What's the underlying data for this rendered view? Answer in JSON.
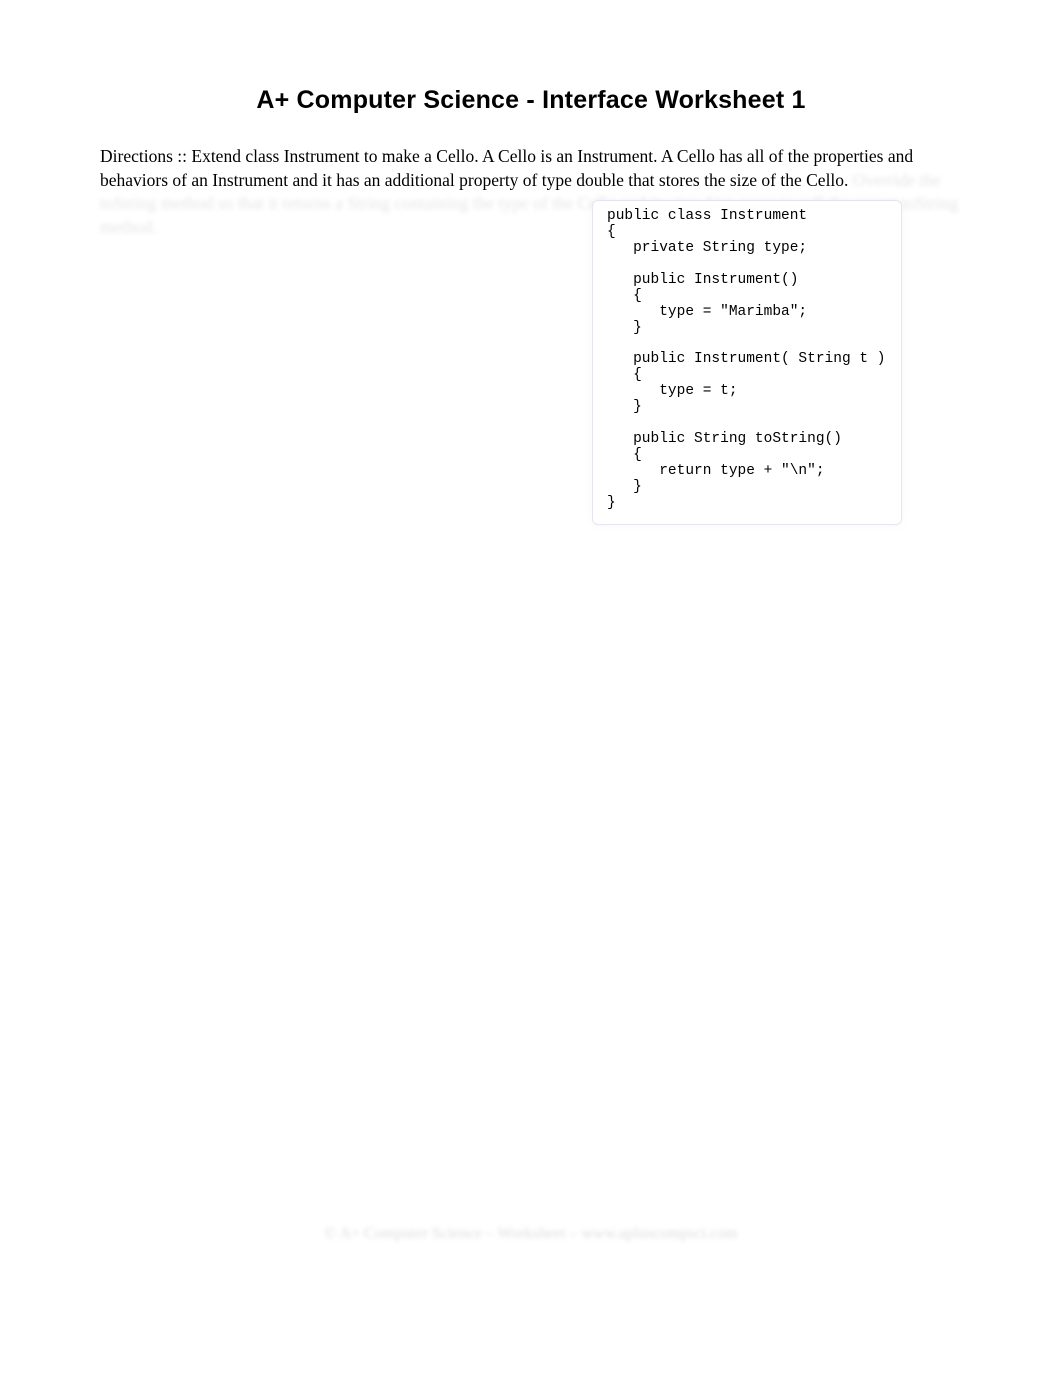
{
  "title": "A+ Computer Science   -   Interface Worksheet 1",
  "directions": {
    "label": "Directions ::",
    "text": " Extend class Instrument to make a Cello.   A Cello is an Instrument.   A Cello has all of the properties and behaviors of an Instrument and it has an additional property of type double that stores the size of the Cello.  ",
    "blurred": "Override the toString method so that it returns a String containing the type of the Cello and its size.   Use super to call the parent toString method."
  },
  "code": "public class Instrument\n{\n   private String type;\n\n   public Instrument()\n   {\n      type = \"Marimba\";\n   }\n\n   public Instrument( String t )\n   {\n      type = t;\n   }\n\n   public String toString()\n   {\n      return type + \"\\n\";\n   }\n}",
  "footer": "© A+ Computer Science – Worksheet – www.apluscompsci.com"
}
